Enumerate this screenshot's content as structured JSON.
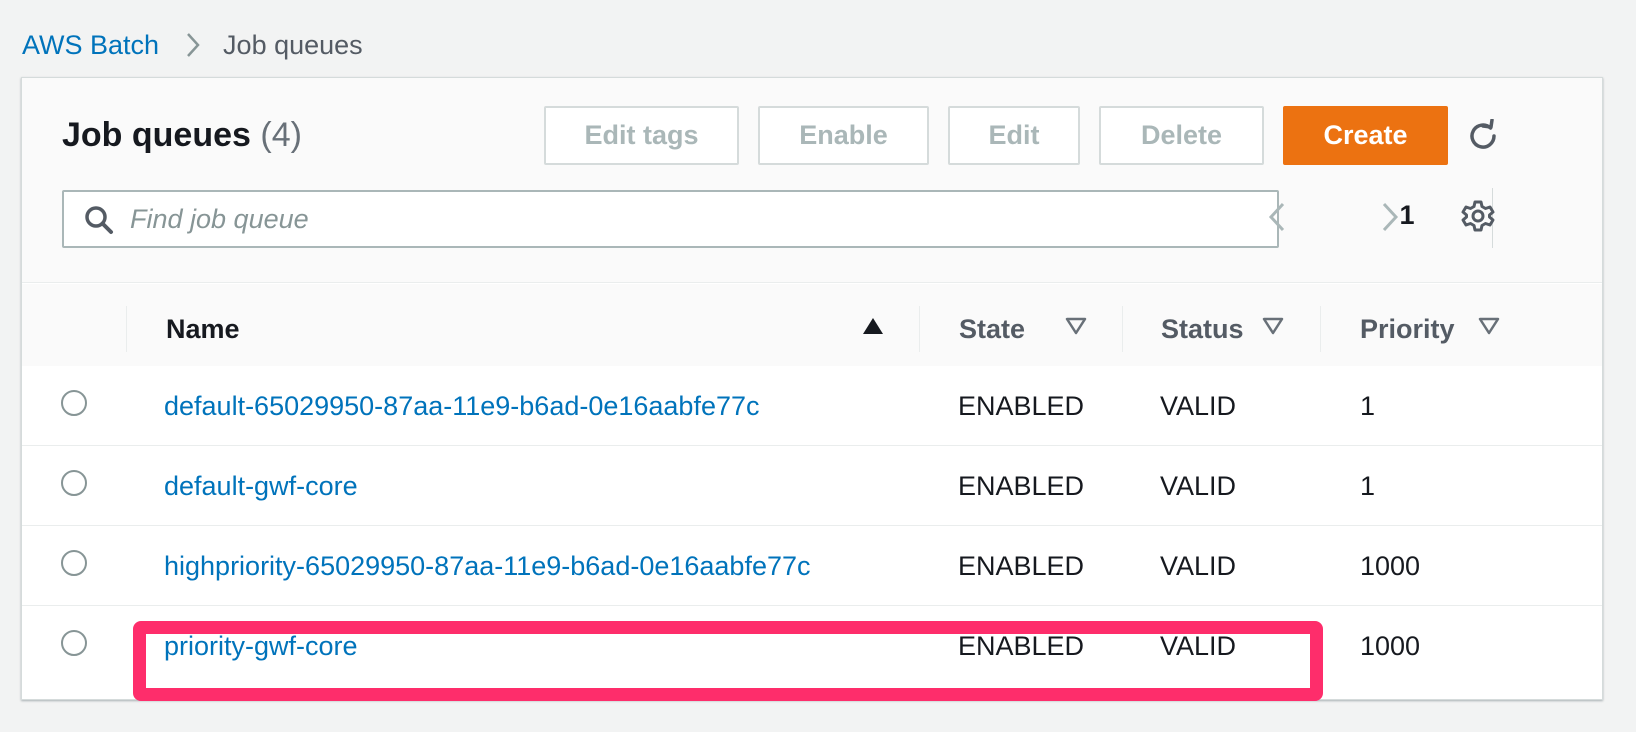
{
  "breadcrumb": {
    "root": "AWS Batch",
    "current": "Job queues"
  },
  "header": {
    "title": "Job queues",
    "count": "(4)"
  },
  "toolbar": {
    "edit_tags": "Edit tags",
    "enable": "Enable",
    "edit": "Edit",
    "delete": "Delete",
    "create": "Create",
    "refresh_icon": "refresh-icon"
  },
  "search": {
    "placeholder": "Find job queue",
    "value": ""
  },
  "pagination": {
    "current_page": "1"
  },
  "table": {
    "columns": {
      "name": "Name",
      "state": "State",
      "status": "Status",
      "priority": "Priority"
    },
    "sort": {
      "column": "Name",
      "direction": "ascending"
    },
    "rows": [
      {
        "name": "default-65029950-87aa-11e9-b6ad-0e16aabfe77c",
        "state": "ENABLED",
        "status": "VALID",
        "priority": "1"
      },
      {
        "name": "default-gwf-core",
        "state": "ENABLED",
        "status": "VALID",
        "priority": "1"
      },
      {
        "name": "highpriority-65029950-87aa-11e9-b6ad-0e16aabfe77c",
        "state": "ENABLED",
        "status": "VALID",
        "priority": "1000"
      },
      {
        "name": "priority-gwf-core",
        "state": "ENABLED",
        "status": "VALID",
        "priority": "1000"
      }
    ],
    "highlighted_row": "priority-gwf-core"
  },
  "colors": {
    "link": "#0073bb",
    "primary_button": "#ec7211",
    "highlight": "#fe2d6b",
    "disabled_text": "#aab7b8"
  }
}
